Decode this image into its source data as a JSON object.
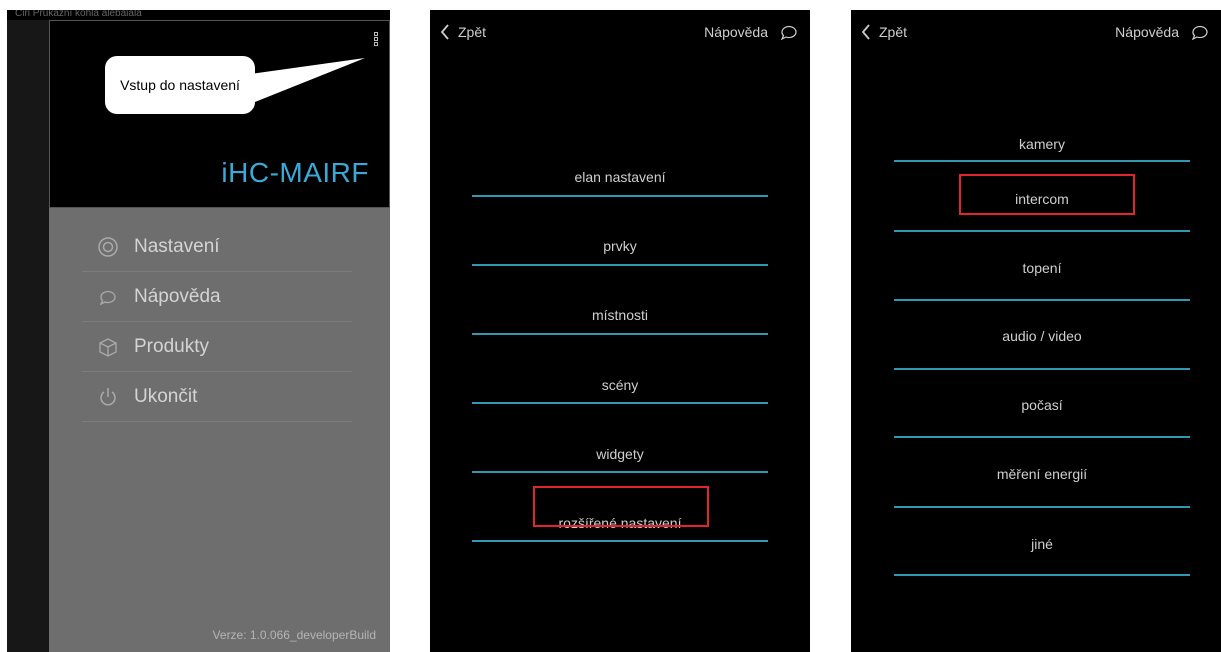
{
  "screen1": {
    "status_text": "Ciri Průkazní kohla alebaiala",
    "brand": "iHC-MAIRF",
    "callout": "Vstup do nastavení",
    "menu": [
      {
        "label": "Nastavení",
        "icon": "gear-icon"
      },
      {
        "label": "Nápověda",
        "icon": "chat-bubble-icon"
      },
      {
        "label": "Produkty",
        "icon": "box-icon"
      },
      {
        "label": "Ukončit",
        "icon": "power-icon"
      }
    ],
    "version": "Verze: 1.0.066_developerBuild"
  },
  "screen2": {
    "back_label": "Zpět",
    "help_label": "Nápověda",
    "items": [
      "elan nastavení",
      "prvky",
      "místnosti",
      "scény",
      "widgety",
      "rozšířené nastavení"
    ],
    "highlighted": "rozšířené nastavení"
  },
  "screen3": {
    "back_label": "Zpět",
    "help_label": "Nápověda",
    "items": [
      "kamery",
      "intercom",
      "topení",
      "audio / video",
      "počasí",
      "měření energií",
      "jiné"
    ],
    "highlighted": "intercom"
  },
  "colors": {
    "accent": "#3497b2",
    "brand": "#3aa9d8",
    "highlight": "#e0262a",
    "drawer": "#6e6e6e"
  }
}
